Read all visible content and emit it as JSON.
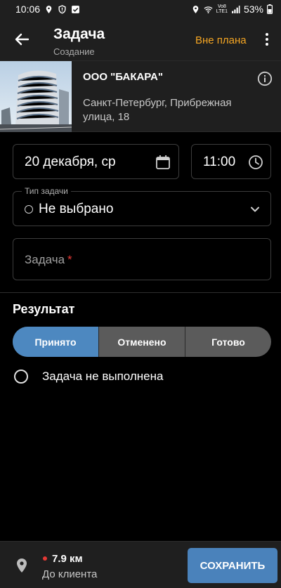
{
  "status_bar": {
    "time": "10:06",
    "battery": "53%",
    "network_top": "Vo8",
    "network_bottom": "LTE1"
  },
  "app_bar": {
    "title": "Задача",
    "subtitle": "Создание",
    "plan_label": "Вне плана",
    "plan_color": "#f5a623"
  },
  "client": {
    "name": "ООО \"БАКАРА\"",
    "address": "Санкт-Петербург,  Прибрежная улица, 18"
  },
  "form": {
    "date": "20 декабря, ср",
    "time": "11:00",
    "type_label": "Тип задачи",
    "type_value": "Не выбрано",
    "task_placeholder": "Задача",
    "task_required_mark": "*"
  },
  "result": {
    "title": "Результат",
    "options": [
      "Принято",
      "Отменено",
      "Готово"
    ],
    "selected": "Принято",
    "not_done_label": "Задача не выполнена"
  },
  "bottom_bar": {
    "distance": "7.9 км",
    "distance_label": "До клиента",
    "save_label": "СОХРАНИТЬ"
  },
  "colors": {
    "accent": "#4d88c0",
    "save_button": "#4a82bb",
    "required": "#e53935",
    "background": "#000000",
    "bar": "#1f1f1f"
  }
}
